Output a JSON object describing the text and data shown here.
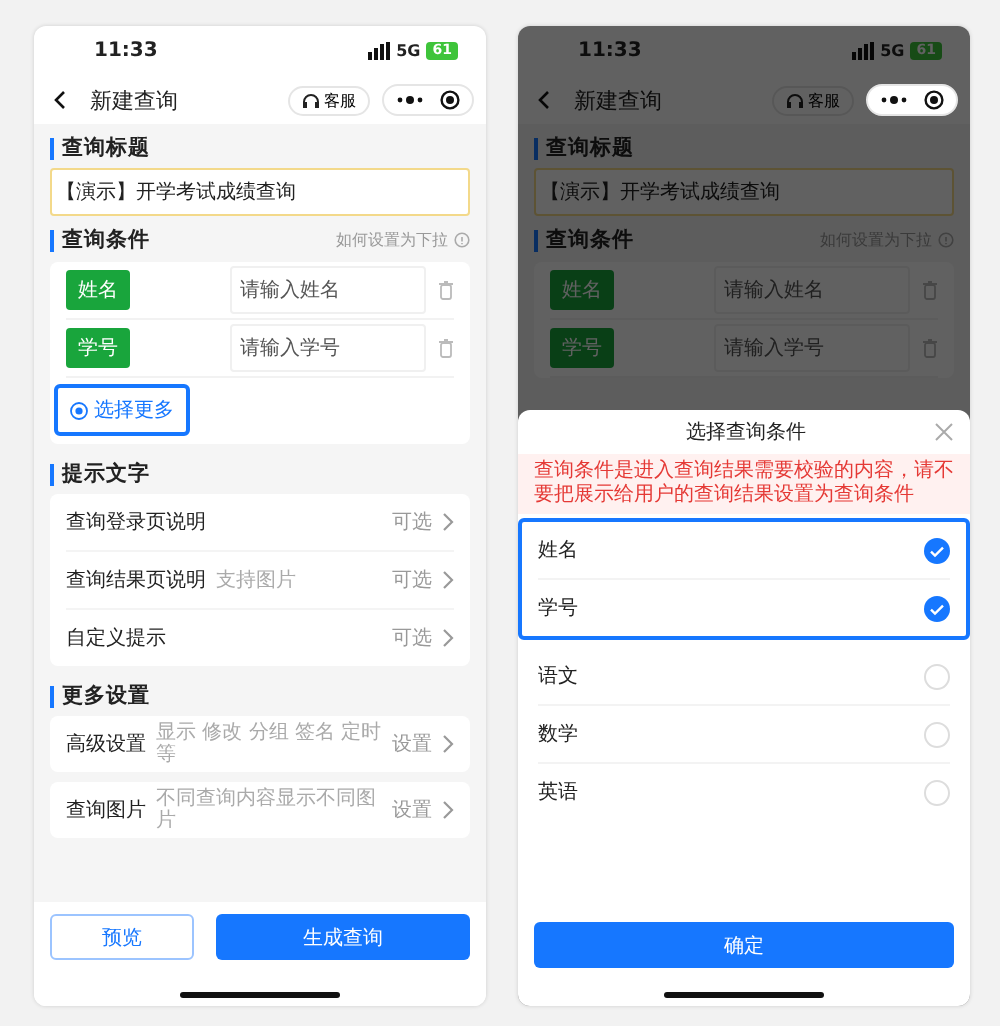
{
  "editor_screen": {
    "status_bar": {
      "time": "11:33",
      "network": "5G",
      "battery": "61"
    },
    "nav": {
      "title": "新建查询",
      "service_label": "客服"
    },
    "sections": [
      {
        "kind": "text_field",
        "title": "查询标题",
        "value": "【演示】开学考试成绩查询"
      },
      {
        "kind": "conditions",
        "title": "查询条件",
        "help": "如何设置为下拉",
        "conditions": [
          {
            "tag": "姓名",
            "placeholder": "请输入姓名"
          },
          {
            "tag": "学号",
            "placeholder": "请输入学号"
          }
        ],
        "more_button": {
          "label": "选择更多",
          "highlighted": true
        }
      },
      {
        "kind": "list",
        "title": "提示文字",
        "cards": [
          [
            {
              "label": "查询登录页说明",
              "action": "可选"
            },
            {
              "label": "查询结果页说明",
              "hint": "支持图片",
              "action": "可选"
            },
            {
              "label": "自定义提示",
              "action": "可选"
            }
          ]
        ]
      },
      {
        "kind": "list",
        "title": "更多设置",
        "cards": [
          [
            {
              "label": "高级设置",
              "hint": "显示 修改 分组 签名 定时等",
              "action": "设置"
            }
          ],
          [
            {
              "label": "查询图片",
              "hint": "不同查询内容显示不同图片",
              "action": "设置"
            }
          ]
        ]
      }
    ],
    "footer": {
      "preview_button": "预览",
      "create_button": "生成查询"
    }
  },
  "picker_screen": {
    "status_bar": {
      "time": "11:33",
      "network": "5G",
      "battery": "61"
    },
    "nav": {
      "title": "新建查询",
      "service_label": "客服"
    },
    "sections": [
      {
        "kind": "text_field",
        "title": "查询标题",
        "value": "【演示】开学考试成绩查询"
      },
      {
        "kind": "conditions",
        "title": "查询条件",
        "help": "如何设置为下拉",
        "conditions": [
          {
            "tag": "姓名",
            "placeholder": "请输入姓名"
          },
          {
            "tag": "学号",
            "placeholder": "请输入学号"
          }
        ]
      }
    ],
    "sheet": {
      "title": "选择查询条件",
      "notice": "查询条件是进入查询结果需要校验的内容，请不要把展示给用户的查询结果设置为查询条件",
      "groups": [
        {
          "highlighted": true,
          "options": [
            {
              "label": "姓名",
              "selected": true
            },
            {
              "label": "学号",
              "selected": true
            }
          ]
        },
        {
          "highlighted": false,
          "options": [
            {
              "label": "语文",
              "selected": false
            },
            {
              "label": "数学",
              "selected": false
            },
            {
              "label": "英语",
              "selected": false
            }
          ]
        }
      ],
      "confirm_button": "确定"
    }
  }
}
